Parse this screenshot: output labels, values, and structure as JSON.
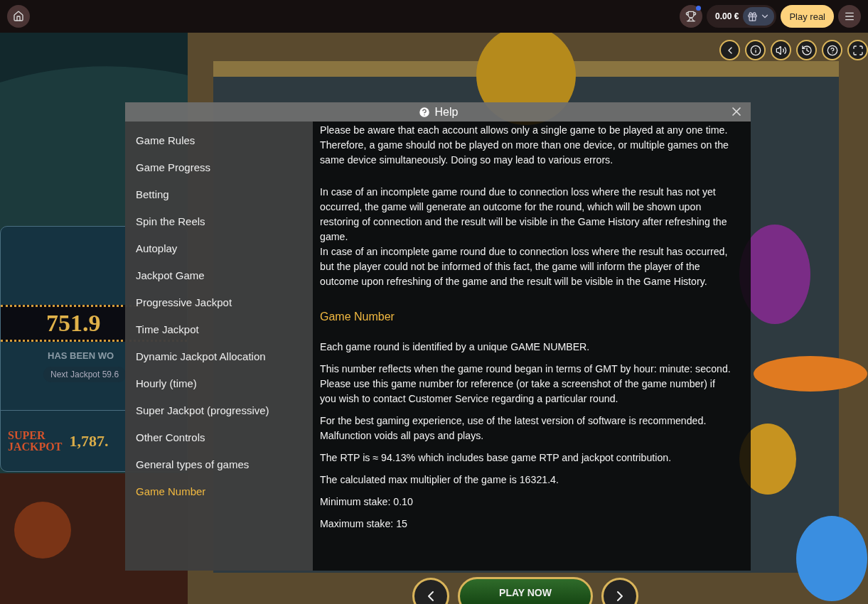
{
  "top_bar": {
    "balance": "0.00 €",
    "play_real": "Play real",
    "trophy_notification": true
  },
  "game_controls": [
    {
      "kind": "back"
    },
    {
      "kind": "info"
    },
    {
      "kind": "sound"
    },
    {
      "kind": "history"
    },
    {
      "kind": "help"
    },
    {
      "kind": "fullscreen"
    }
  ],
  "jackpot_panel": {
    "hourly_amount": "751.9",
    "won_label": "HAS BEEN WO",
    "next_jackpot": "Next Jackpot 59.6",
    "super_label_1": "SUPER",
    "super_label_2": "JACKPOT",
    "super_amount": "1,787."
  },
  "help": {
    "title": "Help",
    "sidebar": [
      {
        "label": "Game Rules",
        "selected": false
      },
      {
        "label": "Game Progress",
        "selected": false
      },
      {
        "label": "Betting",
        "selected": false
      },
      {
        "label": "Spin the Reels",
        "selected": false
      },
      {
        "label": "Autoplay",
        "selected": false
      },
      {
        "label": "Jackpot Game",
        "selected": false
      },
      {
        "label": "Progressive Jackpot",
        "selected": false
      },
      {
        "label": "Time Jackpot",
        "selected": false
      },
      {
        "label": "Dynamic Jackpot Allocation",
        "selected": false
      },
      {
        "label": "Hourly (time)",
        "selected": false
      },
      {
        "label": "Super Jackpot (progressive)",
        "selected": false
      },
      {
        "label": "Other Controls",
        "selected": false
      },
      {
        "label": "General types of games",
        "selected": false
      },
      {
        "label": "Game Number",
        "selected": true
      }
    ],
    "content": [
      {
        "kind": "paragraph",
        "text": "Please be aware that each account allows only a single game to be played at any one time. Therefore, a game should not be played on more than one device, or multiple games on the same device simultaneously. Doing so may lead to various errors."
      },
      {
        "kind": "spacer"
      },
      {
        "kind": "tight",
        "text": "In case of an incomplete game round due to connection loss where the result has not yet occurred, the game will generate an outcome for the round, which will be shown upon restoring of connection and the result will be visible in the Game History after refreshing the game."
      },
      {
        "kind": "paragraph",
        "text": "In case of an incomplete game round due to connection loss where the result has occurred, but the player could not be informed of this fact, the game will inform the player of the outcome upon refreshing of the game and the result will be visible in the Game History."
      },
      {
        "kind": "heading",
        "text": "Game Number"
      },
      {
        "kind": "paragraph",
        "text": "Each game round is identified by a unique GAME NUMBER."
      },
      {
        "kind": "paragraph",
        "text": "This number reflects when the game round began in terms of GMT by hour: minute: second. Please use this game number for reference (or take a screenshot of the game number) if you wish to contact Customer Service regarding a particular round."
      },
      {
        "kind": "paragraph",
        "text": "For the best gaming experience, use of the latest version of software is recommended. Malfunction voids all pays and plays."
      },
      {
        "kind": "paragraph",
        "text": "The RTP is ≈ 94.13% which includes base game RTP and jackpot contribution."
      },
      {
        "kind": "paragraph",
        "text": "The calculated max multiplier of the game is 16321.4."
      },
      {
        "kind": "paragraph",
        "text": "Minimum stake: 0.10"
      },
      {
        "kind": "paragraph",
        "text": "Maximum stake: 15"
      }
    ]
  },
  "bottom": {
    "play_now": "PLAY NOW"
  }
}
